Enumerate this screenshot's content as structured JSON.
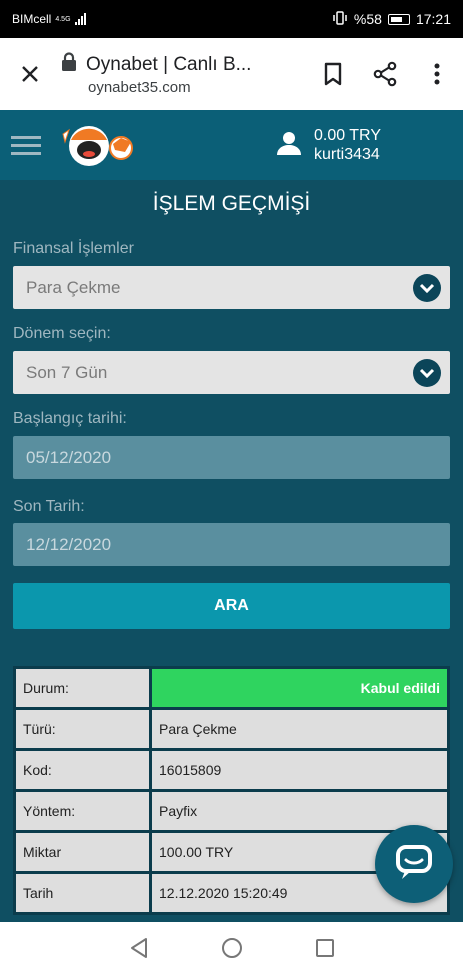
{
  "status_bar": {
    "carrier": "BIMcell",
    "network": "4.5G",
    "battery": "%58",
    "time": "17:21"
  },
  "browser": {
    "title": "Oynabet | Canlı B...",
    "url": "oynabet35.com",
    "icons": [
      "close-icon",
      "lock-icon",
      "bookmark-icon",
      "share-icon",
      "more-icon"
    ]
  },
  "header": {
    "balance": "0.00 TRY",
    "username": "kurti3434"
  },
  "page": {
    "title": "İŞLEM GEÇMİŞİ",
    "fields": {
      "financial_label": "Finansal İşlemler",
      "financial_value": "Para Çekme",
      "period_label": "Dönem seçin:",
      "period_value": "Son 7 Gün",
      "start_label": "Başlangıç tarihi:",
      "start_value": "05/12/2020",
      "end_label": "Son Tarih:",
      "end_value": "12/12/2020"
    },
    "search_button": "ARA"
  },
  "result": {
    "rows": [
      {
        "key": "Durum:",
        "value": "Kabul edildi"
      },
      {
        "key": "Türü:",
        "value": "Para Çekme"
      },
      {
        "key": "Kod:",
        "value": "16015809"
      },
      {
        "key": "Yöntem:",
        "value": "Payfix"
      },
      {
        "key": "Miktar",
        "value": "100.00 TRY"
      },
      {
        "key": "Tarih",
        "value": "12.12.2020 15:20:49"
      }
    ]
  },
  "colors": {
    "header_bg": "#0b5f77",
    "page_bg": "#0f4f62",
    "button": "#0b97ad",
    "status_ok": "#2fd45f"
  }
}
